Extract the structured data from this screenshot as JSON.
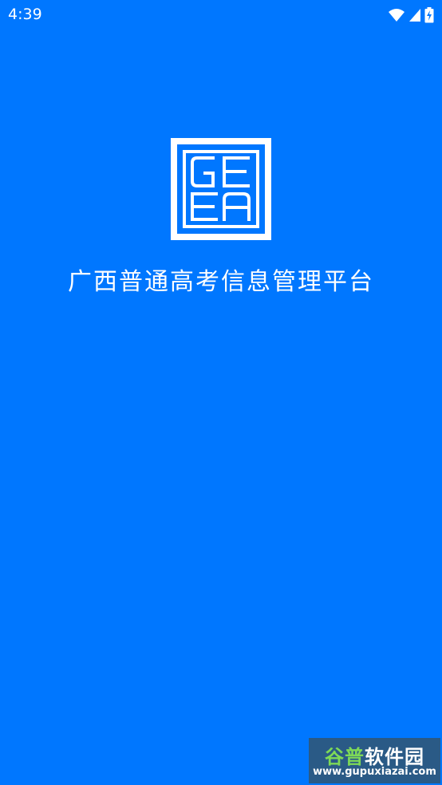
{
  "status_bar": {
    "time": "4:39",
    "icons": [
      "wifi-icon",
      "cell-signal-icon",
      "battery-charging-icon"
    ]
  },
  "splash": {
    "logo_text": [
      "G",
      "E",
      "E",
      "A"
    ],
    "title": "广西普通高考信息管理平台"
  },
  "watermark": {
    "brand_part1": "谷普",
    "brand_part2": "软件园",
    "url": "www.gupuxiazai.com"
  },
  "colors": {
    "background": "#0077FF",
    "foreground": "#FFFFFF",
    "watermark_bg": "#2A5A86",
    "watermark_accent": "#7ED957"
  }
}
